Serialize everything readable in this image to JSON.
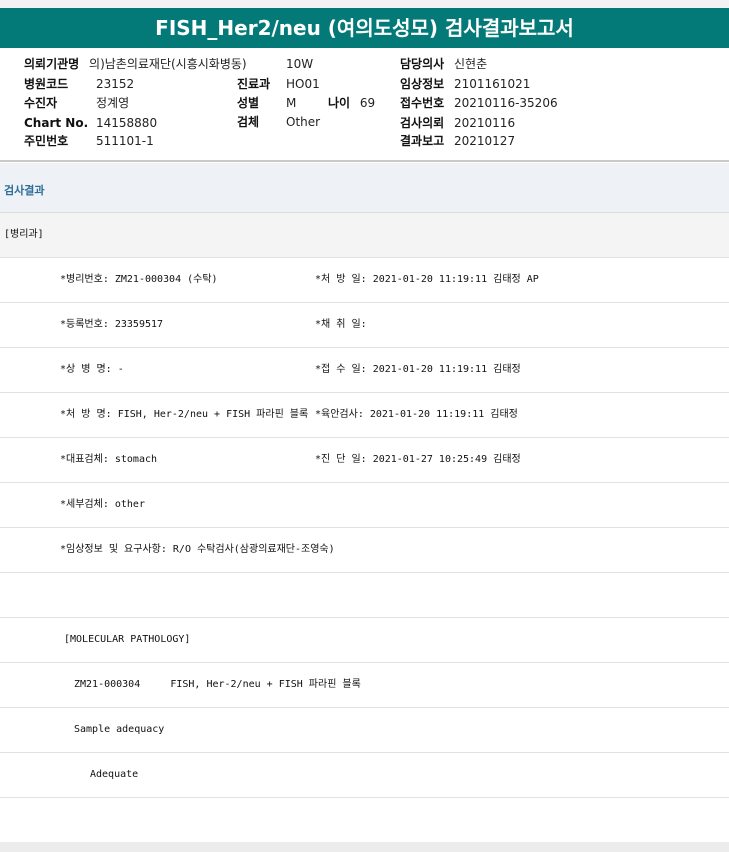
{
  "report": {
    "title": "FISH_Her2/neu (여의도성모) 검사결과보고서"
  },
  "header": {
    "institution_label": "의뢰기관명",
    "institution_value": "의)남촌의료재단(시흥시화병동)",
    "ward_value": "10W",
    "doctor_label": "담당의사",
    "doctor_value": "신현춘",
    "hospital_code_label": "병원코드",
    "hospital_code_value": "23152",
    "dept_label": "진료과",
    "dept_value": "HO01",
    "clinical_info_label": "임상정보",
    "clinical_info_value": "2101161021",
    "patient_label": "수진자",
    "patient_value": "정계영",
    "sex_label": "성별",
    "sex_value": "M",
    "age_label": "나이",
    "age_value": "69",
    "receipt_no_label": "접수번호",
    "receipt_no_value": "20210116-35206",
    "chart_label": "Chart No.",
    "chart_value": "14158880",
    "specimen_label": "검체",
    "specimen_value": "Other",
    "request_label": "검사의뢰",
    "request_value": "20210116",
    "id_label": "주민번호",
    "id_value": "511101-1",
    "report_label": "결과보고",
    "report_value": "20210127"
  },
  "section": {
    "title": "검사결과"
  },
  "rows": [
    {
      "left": "[병리과]",
      "right": ""
    },
    {
      "left": "*병리번호: ZM21-000304 (수탁)",
      "right": "*처 방 일: 2021-01-20 11:19:11  김태정 AP"
    },
    {
      "left": "*등록번호: 23359517",
      "right": "*채 취 일:"
    },
    {
      "left": "*상 병 명: -",
      "right": "*접 수 일: 2021-01-20 11:19:11  김태정"
    },
    {
      "left": "*처 방 명: FISH, Her-2/neu + FISH 파라핀 블록",
      "right": "*육안검사: 2021-01-20 11:19:11  김태정"
    },
    {
      "left": "*대표검체: stomach",
      "right": "*진 단 일: 2021-01-27 10:25:49  김태정"
    },
    {
      "left": "*세부검체: other",
      "right": ""
    },
    {
      "left": "*임상정보 및 요구사항: R/O 수탁검사(삼광의료재단-조영숙)",
      "right": ""
    },
    {
      "left": "",
      "right": ""
    },
    {
      "left": "[MOLECULAR PATHOLOGY]",
      "right": ""
    },
    {
      "left": "ZM21-000304     FISH, Her-2/neu + FISH 파라핀 블록",
      "right": ""
    },
    {
      "left": "Sample adequacy",
      "right": ""
    },
    {
      "left": "Adequate",
      "right": ""
    }
  ]
}
